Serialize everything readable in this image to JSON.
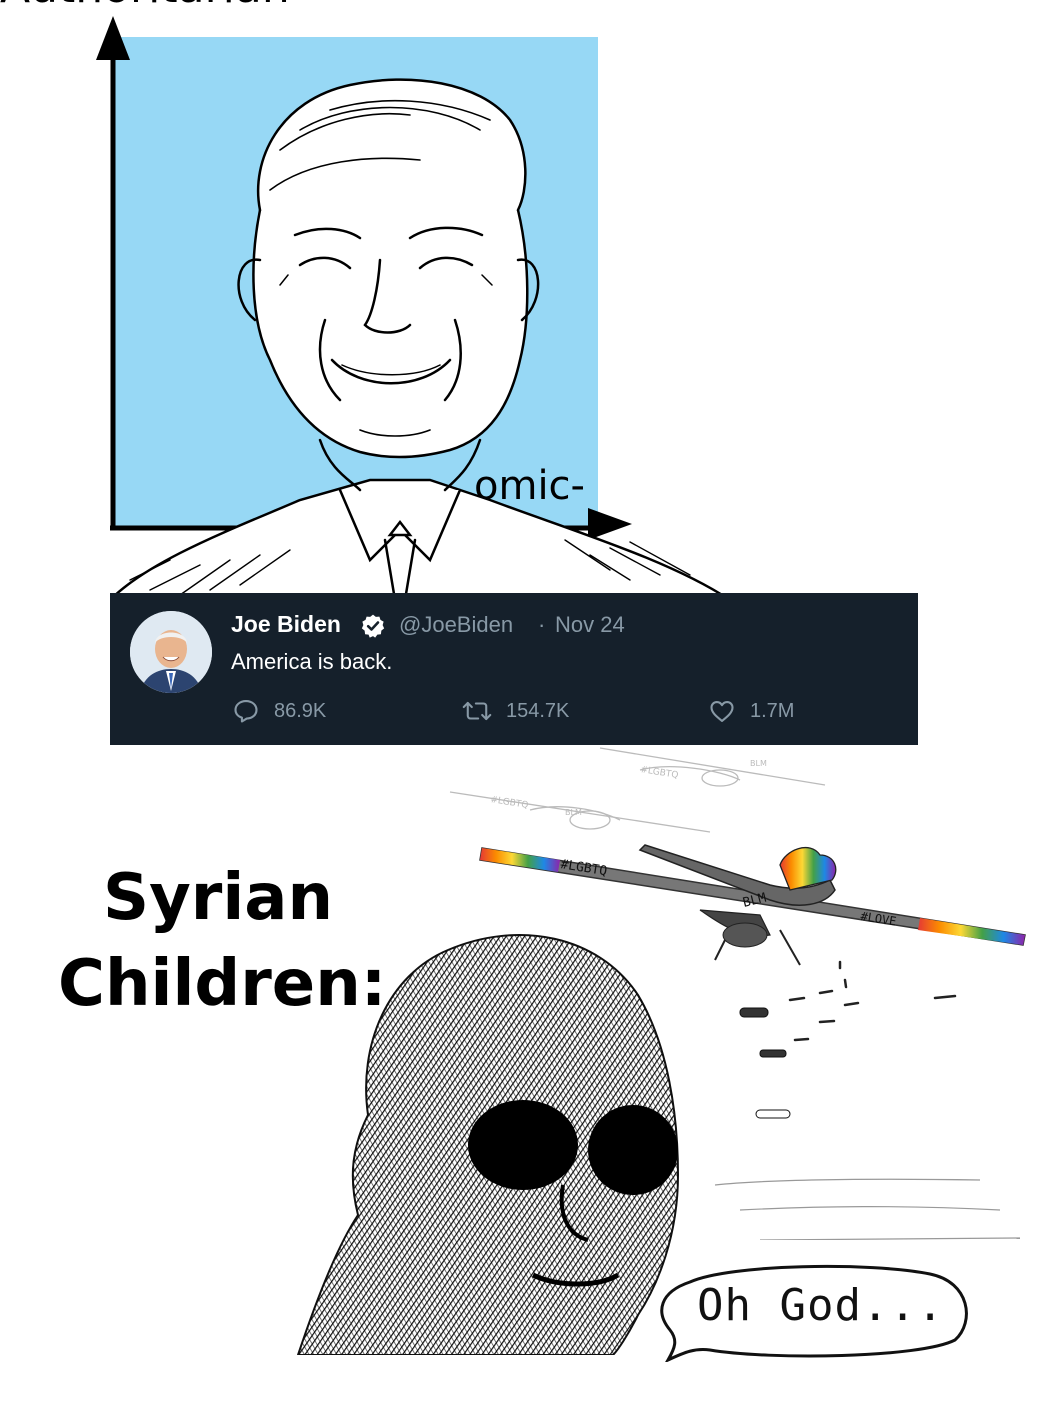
{
  "compass": {
    "top_label": "Authoritarian",
    "right_label": "omic-",
    "background_color": "#97d8f5"
  },
  "tweet": {
    "display_name": "Joe Biden",
    "handle": "@JoeBiden",
    "separator": "·",
    "date": "Nov 24",
    "text": "America is back.",
    "replies": "86.9K",
    "retweets": "154.7K",
    "likes": "1.7M",
    "background_color": "#15202b",
    "secondary_text_color": "#8899a6",
    "icons": [
      "verified-icon",
      "reply-icon",
      "retweet-icon",
      "like-icon"
    ]
  },
  "caption": {
    "line1": "Syrian",
    "line2": "Children:"
  },
  "drone": {
    "tags": [
      "#LGBTQ",
      "BLM",
      "#LOVE"
    ]
  },
  "speech_bubble": {
    "text": "Oh God..."
  }
}
